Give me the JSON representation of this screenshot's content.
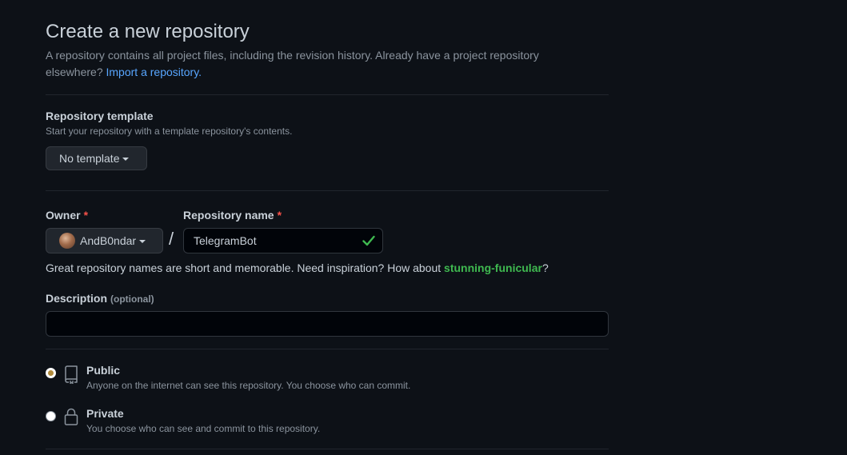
{
  "header": {
    "title": "Create a new repository",
    "intro_text": "A repository contains all project files, including the revision history. Already have a project repository elsewhere?",
    "import_link": "Import a repository."
  },
  "template": {
    "label": "Repository template",
    "description": "Start your repository with a template repository's contents.",
    "button_label": "No template"
  },
  "owner": {
    "label": "Owner",
    "required_mark": "*",
    "value": "AndB0ndar"
  },
  "repo_name": {
    "label": "Repository name",
    "required_mark": "*",
    "value": "TelegramBot",
    "valid": true
  },
  "separator": "/",
  "name_hint": {
    "text": "Great repository names are short and memorable. Need inspiration? How about",
    "suggestion": "stunning-funicular",
    "suffix": "?"
  },
  "description": {
    "label": "Description",
    "optional_label": "(optional)",
    "value": ""
  },
  "visibility": {
    "options": [
      {
        "title": "Public",
        "description": "Anyone on the internet can see this repository. You choose who can commit.",
        "icon": "repo-icon",
        "selected": true
      },
      {
        "title": "Private",
        "description": "You choose who can see and commit to this repository.",
        "icon": "lock-icon",
        "selected": false
      }
    ]
  },
  "colors": {
    "background": "#0d1117",
    "link": "#58a6ff",
    "success": "#3fb950",
    "required": "#f85149"
  }
}
